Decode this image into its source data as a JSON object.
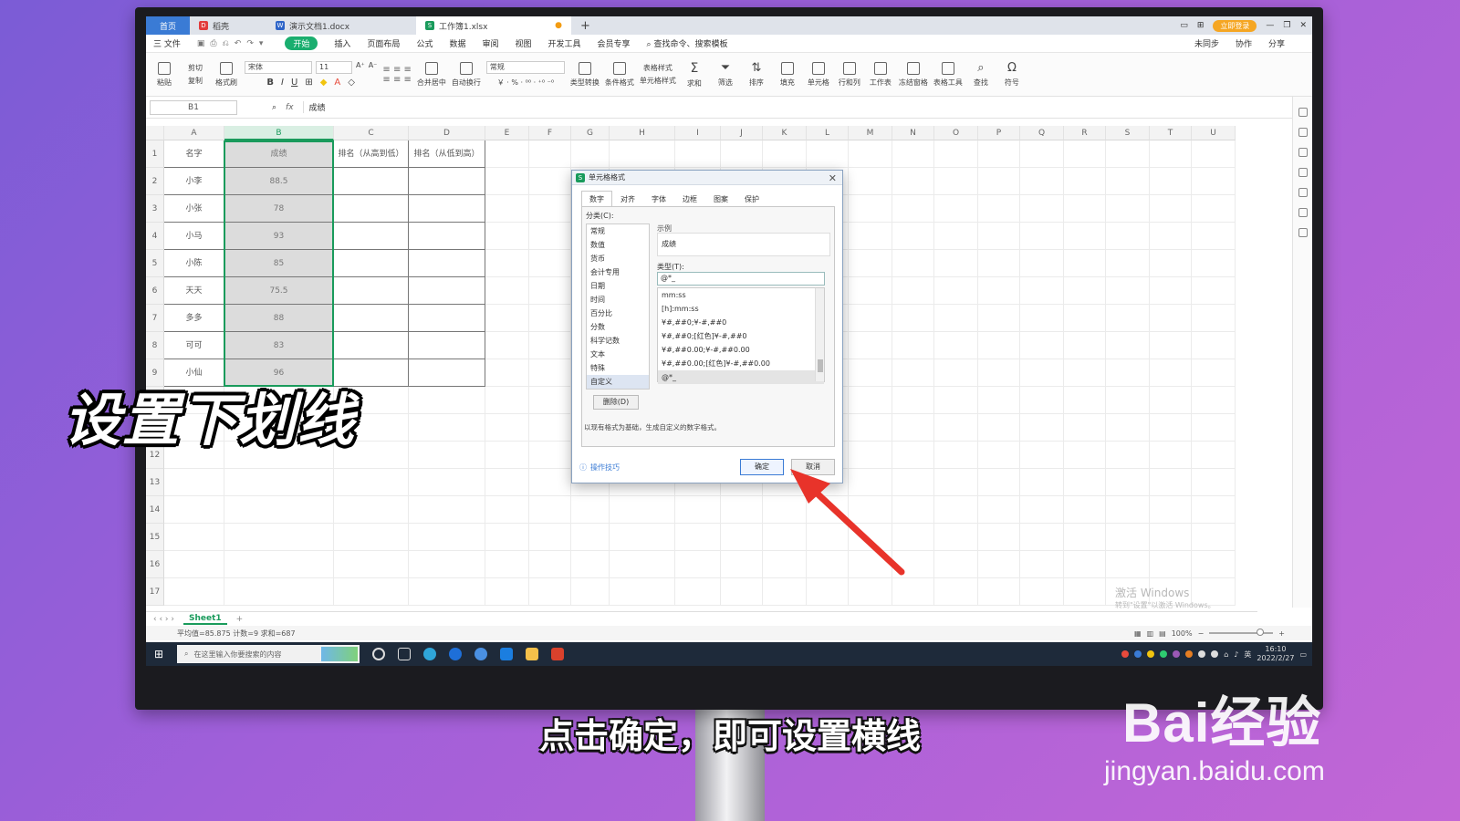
{
  "titlebar": {
    "home_tab": "首页",
    "tabs": [
      "稻壳",
      "演示文档1.docx",
      "工作簿1.xlsx"
    ],
    "login_label": "立即登录"
  },
  "menubar": {
    "file": "三 文件",
    "start": "开始",
    "items": [
      "插入",
      "页面布局",
      "公式",
      "数据",
      "审阅",
      "视图",
      "开发工具",
      "会员专享"
    ],
    "search": "查找命令、搜索模板",
    "right": [
      "未同步",
      "协作",
      "分享"
    ]
  },
  "ribbon": {
    "paste": "粘贴",
    "cut": "剪切",
    "copy": "复制",
    "format_painter": "格式刷",
    "font_name": "宋体",
    "font_size": "11",
    "merge": "合并居中",
    "wrap": "自动换行",
    "number_format": "常规",
    "convert": "类型转换",
    "cond_format": "条件格式",
    "table_style": "表格样式",
    "cell_style": "单元格样式",
    "sum": "求和",
    "filter": "筛选",
    "sort": "排序",
    "fill": "填充",
    "cells": "单元格",
    "rowcol": "行和列",
    "sheet": "工作表",
    "freeze": "冻结窗格",
    "table_tools": "表格工具",
    "find": "查找",
    "symbol": "符号"
  },
  "formula_bar": {
    "name_box": "B1",
    "fx": "fx",
    "content": "成绩"
  },
  "columns": [
    "A",
    "B",
    "C",
    "D",
    "E",
    "F",
    "G",
    "H",
    "I",
    "J",
    "K",
    "L",
    "M",
    "N",
    "O",
    "P",
    "Q",
    "R",
    "S",
    "T",
    "U"
  ],
  "rows": [
    "1",
    "2",
    "3",
    "4",
    "5",
    "6",
    "7",
    "8",
    "9",
    "10",
    "11",
    "12",
    "13",
    "14",
    "15",
    "16",
    "17"
  ],
  "table": {
    "headers": [
      "名字",
      "成绩",
      "排名（从高到低）",
      "排名（从低到高）"
    ],
    "data": [
      [
        "小李",
        "88.5"
      ],
      [
        "小张",
        "78"
      ],
      [
        "小马",
        "93"
      ],
      [
        "小陈",
        "85"
      ],
      [
        "天天",
        "75.5"
      ],
      [
        "多多",
        "88"
      ],
      [
        "可可",
        "83"
      ],
      [
        "小仙",
        "96"
      ]
    ]
  },
  "sheetbar": {
    "sheet1": "Sheet1",
    "add": "+"
  },
  "status": {
    "summary": "平均值=85.875  计数=9  求和=687",
    "zoom": "100%"
  },
  "watermark": {
    "line1": "激活 Windows",
    "line2": "转到\"设置\"以激活 Windows。"
  },
  "taskbar": {
    "search_placeholder": "在这里输入你要搜索的内容",
    "time": "16:10",
    "date": "2022/2/27",
    "lang": "英"
  },
  "dialog": {
    "title": "单元格格式",
    "tabs": [
      "数字",
      "对齐",
      "字体",
      "边框",
      "图案",
      "保护"
    ],
    "category_label": "分类(C):",
    "categories": [
      "常规",
      "数值",
      "货币",
      "会计专用",
      "日期",
      "时间",
      "百分比",
      "分数",
      "科学记数",
      "文本",
      "特殊",
      "自定义"
    ],
    "sample_label": "示例",
    "sample_value": "成绩",
    "type_label": "类型(T):",
    "type_value": "@*_",
    "type_list": [
      "mm:ss",
      "[h]:mm:ss",
      "¥#,##0;¥-#,##0",
      "¥#,##0;[红色]¥-#,##0",
      "¥#,##0.00;¥-#,##0.00",
      "¥#,##0.00;[红色]¥-#,##0.00",
      "@*_"
    ],
    "delete_button": "删除(D)",
    "description": "以现有格式为基础，生成自定义的数字格式。",
    "tips": "操作技巧",
    "ok": "确定",
    "cancel": "取消"
  },
  "overlay": {
    "title": "设置下划线",
    "subtitle": "点击确定，即可设置横线",
    "brand": "Bai经验",
    "brand_url": "jingyan.baidu.com"
  },
  "colors": {
    "accent_green": "#1a9b5c",
    "arrow_red": "#e8332a",
    "wps_blue": "#3a7bd5"
  }
}
